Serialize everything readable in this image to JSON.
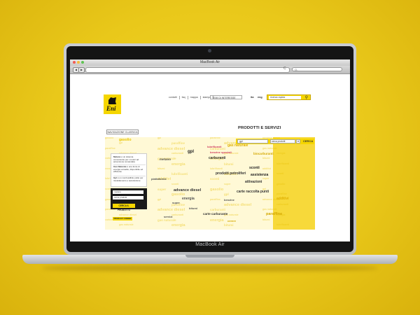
{
  "window_title": "MacBook Air",
  "laptop_brand": "MacBook Air",
  "colors": {
    "brand_yellow": "#f5d600",
    "background": "#e9c81a"
  },
  "browser": {
    "back_icon": "back-arrow-icon",
    "forward_icon": "forward-arrow-icon",
    "reload_label": "C",
    "search_placeholder": "Q-"
  },
  "header": {
    "logo_text": "Eni",
    "nav_links": [
      "contatti",
      "faq",
      "mappa",
      "stampa"
    ],
    "theme_select": "TEMI DI INTERESSE",
    "lang_it": "ita",
    "lang_en": "eng",
    "quick_search": "ricerca rapida"
  },
  "page": {
    "classic_nav_label": "NAVIGAZIONE CLASSICA",
    "section_title": "PRODOTTI E SERVIZI",
    "search_value": "gpl",
    "search_scope": "cerca prodotti",
    "search_button": "CERCA"
  },
  "word_cloud": [
    "gasolio",
    "gpl",
    "metano",
    "carburanti",
    "gas naturale",
    "prodotti petroliferi",
    "biocarburanti",
    "lubrificanti",
    "sconti",
    "assistenza",
    "attivazioni",
    "advance diesel",
    "energia",
    "paraffine",
    "bitumi",
    "additivi",
    "carte raccolta punti",
    "benzine speciali",
    "super",
    "piattaforme",
    "benzine",
    "carte carburante",
    "servizi",
    "cerere"
  ],
  "panel": {
    "items": [
      {
        "title": "Metano",
        "text": "è un sistema conveniente per i motori ad accensione comandata"
      },
      {
        "title": "Gas Naturale",
        "text": "è una fonte di energia versatile, disponibile ed efficiente"
      },
      {
        "title": "Gpl",
        "text": "è un combustibile pulito per riscaldamento e autotrazione"
      }
    ]
  },
  "form": {
    "field1": "metano",
    "field2": "cerca prodotti",
    "button": "CERCA IL PRODOTTO"
  },
  "product_label": "PRODUCT FINDER"
}
